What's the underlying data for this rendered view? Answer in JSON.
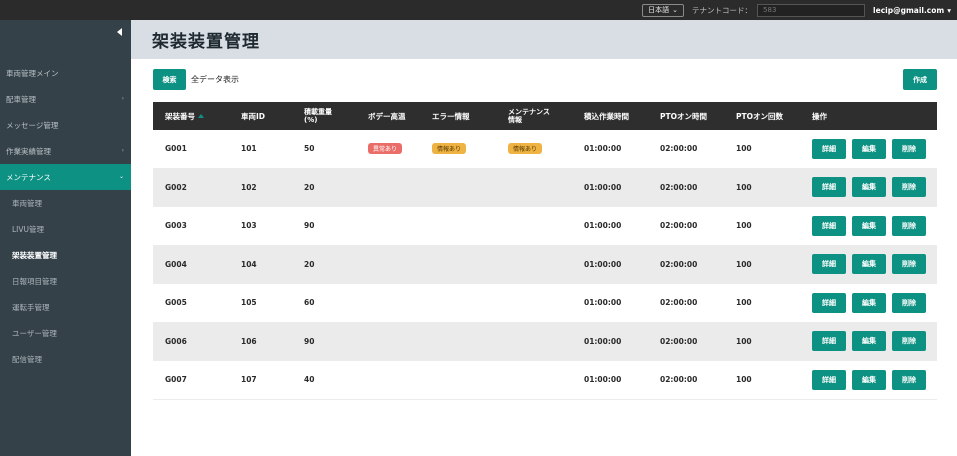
{
  "topbar": {
    "language": "日本語",
    "tenant_label": "テナントコード：",
    "tenant_code": "583",
    "user": "lecip@gmail.com"
  },
  "sidebar": {
    "items": [
      {
        "label": "車両管理メイン",
        "chevron": ""
      },
      {
        "label": "配車管理",
        "chevron": "›"
      },
      {
        "label": "メッセージ管理",
        "chevron": ""
      },
      {
        "label": "作業実績管理",
        "chevron": "›"
      },
      {
        "label": "メンテナンス",
        "chevron": "⌄"
      },
      {
        "label": "車両管理",
        "chevron": ""
      },
      {
        "label": "LIVU管理",
        "chevron": ""
      },
      {
        "label": "架装装置管理",
        "chevron": ""
      },
      {
        "label": "日報項目管理",
        "chevron": ""
      },
      {
        "label": "運転手管理",
        "chevron": ""
      },
      {
        "label": "ユーザー管理",
        "chevron": ""
      },
      {
        "label": "配信管理",
        "chevron": ""
      }
    ]
  },
  "page": {
    "title": "架装装置管理",
    "search_label": "検索",
    "show_all_label": "全データ表示",
    "create_label": "作成"
  },
  "table": {
    "headers": [
      "架装番号",
      "車両ID",
      "積載重量\n(%)",
      "ボデー高温",
      "エラー情報",
      "メンテナンス\n情報",
      "積込作業時間",
      "PTOオン時間",
      "PTOオン回数",
      "操作"
    ],
    "ops": {
      "detail": "詳細",
      "edit": "編集",
      "delete": "削除"
    },
    "rows": [
      {
        "id": "G001",
        "vehicle": "101",
        "load": "50",
        "body_temp": "異常あり",
        "error": "情報あり",
        "maint": "情報あり",
        "loading_time": "01:00:00",
        "pto_time": "02:00:00",
        "pto_count": "100"
      },
      {
        "id": "G002",
        "vehicle": "102",
        "load": "20",
        "body_temp": "",
        "error": "",
        "maint": "",
        "loading_time": "01:00:00",
        "pto_time": "02:00:00",
        "pto_count": "100"
      },
      {
        "id": "G003",
        "vehicle": "103",
        "load": "90",
        "body_temp": "",
        "error": "",
        "maint": "",
        "loading_time": "01:00:00",
        "pto_time": "02:00:00",
        "pto_count": "100"
      },
      {
        "id": "G004",
        "vehicle": "104",
        "load": "20",
        "body_temp": "",
        "error": "",
        "maint": "",
        "loading_time": "01:00:00",
        "pto_time": "02:00:00",
        "pto_count": "100"
      },
      {
        "id": "G005",
        "vehicle": "105",
        "load": "60",
        "body_temp": "",
        "error": "",
        "maint": "",
        "loading_time": "01:00:00",
        "pto_time": "02:00:00",
        "pto_count": "100"
      },
      {
        "id": "G006",
        "vehicle": "106",
        "load": "90",
        "body_temp": "",
        "error": "",
        "maint": "",
        "loading_time": "01:00:00",
        "pto_time": "02:00:00",
        "pto_count": "100"
      },
      {
        "id": "G007",
        "vehicle": "107",
        "load": "40",
        "body_temp": "",
        "error": "",
        "maint": "",
        "loading_time": "01:00:00",
        "pto_time": "02:00:00",
        "pto_count": "100"
      }
    ]
  },
  "colors": {
    "accent": "#0d9183",
    "sidebar": "#344149",
    "header_bg": "#d8dee4",
    "alert": "#ea6d67",
    "info": "#eeb343"
  },
  "icons": {
    "sidebar_toggle": "caret-left-icon",
    "sort": "sort-asc-icon",
    "dropdown": "chevron-down-icon"
  }
}
